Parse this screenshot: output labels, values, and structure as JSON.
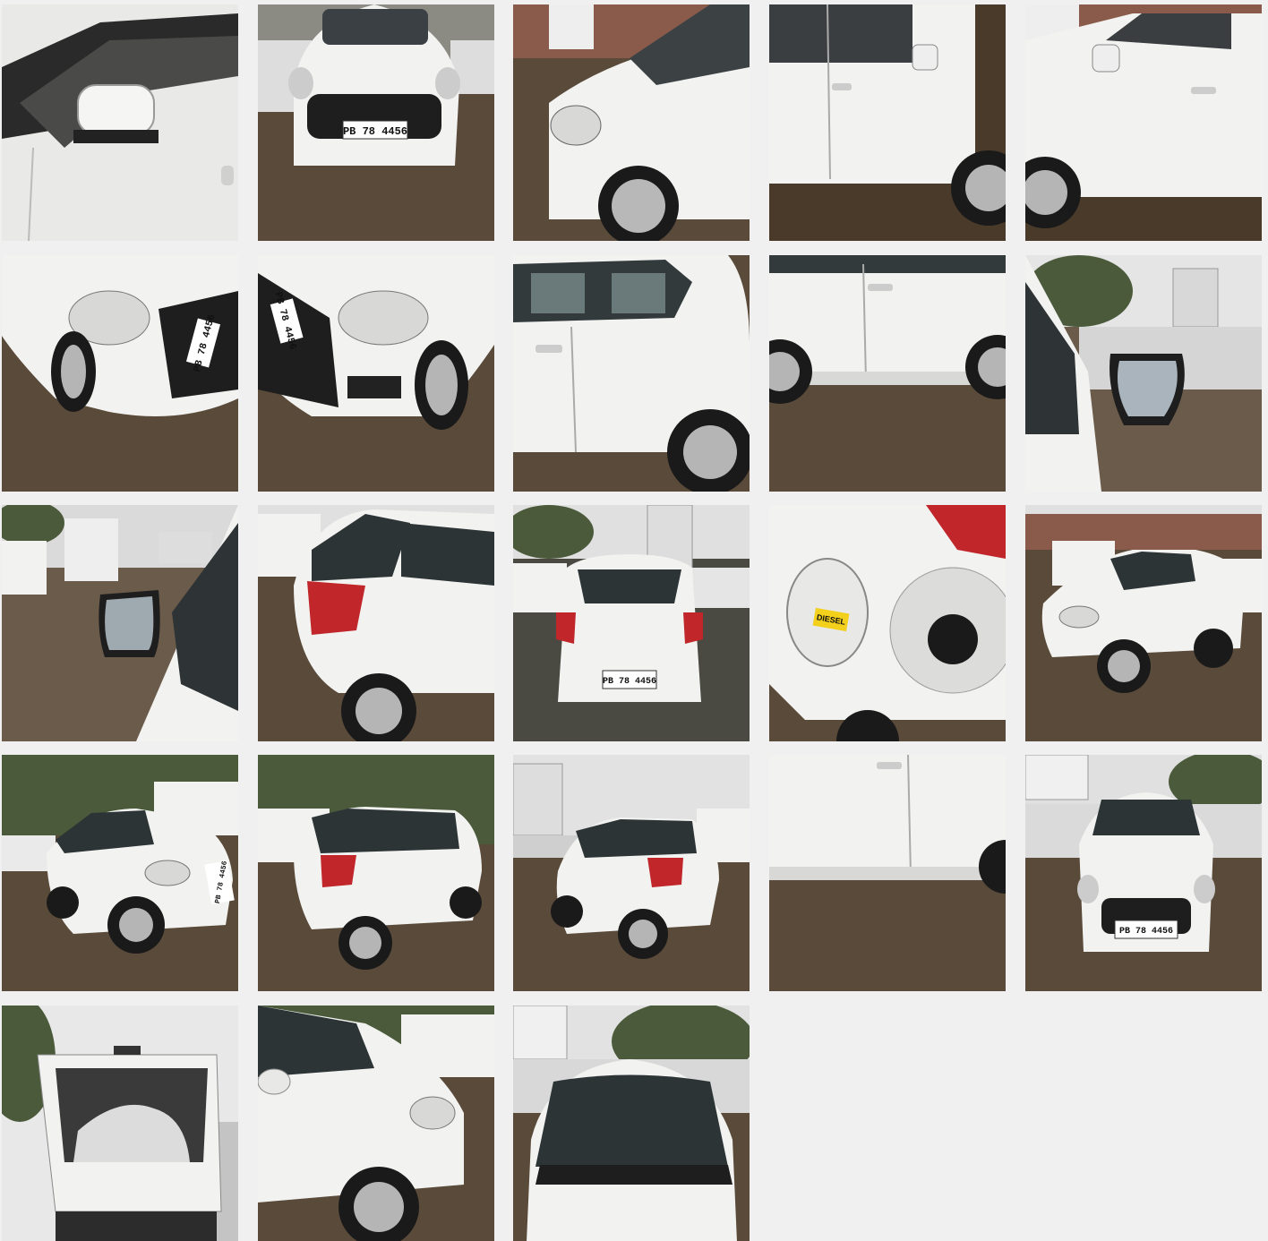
{
  "gallery": {
    "photos": [
      {
        "view": "left-mirror-closeup"
      },
      {
        "view": "front",
        "plate": "PB 78 4456"
      },
      {
        "view": "front-left-fender"
      },
      {
        "view": "right-doors"
      },
      {
        "view": "front-right-door"
      },
      {
        "view": "front-right-quarter-low",
        "plate": "PB 78 4456"
      },
      {
        "view": "front-left-quarter-low",
        "plate": "PB 78 4456"
      },
      {
        "view": "rear-right-door"
      },
      {
        "view": "left-doors-low"
      },
      {
        "view": "right-mirror-interior"
      },
      {
        "view": "left-mirror-yard"
      },
      {
        "view": "rear-left-quarter"
      },
      {
        "view": "rear",
        "plate": "PB 78 4456"
      },
      {
        "view": "fuel-lid-open",
        "sticker": "DIESEL"
      },
      {
        "view": "front-right-quarter-yard"
      },
      {
        "view": "front-right-quarter-trees",
        "plate": "PB 78 4456"
      },
      {
        "view": "rear-left-quarter-trees"
      },
      {
        "view": "rear-left-quarter-buildings"
      },
      {
        "view": "left-doors-closeup"
      },
      {
        "view": "front-yard",
        "plate": "PB 78 4456"
      },
      {
        "view": "tailgate-open"
      },
      {
        "view": "front-left-wheel"
      },
      {
        "view": "windscreen-bonnet"
      }
    ]
  },
  "colors": {
    "background": "#f0f0f0",
    "car_body": "#f2f2f0",
    "ground": "#5a4a3a",
    "sky": "#dcdcdc",
    "trees": "#4a5a3a",
    "plate": "#ffffff",
    "sticker": "#f2d01c",
    "tail_light": "#c0262a"
  }
}
